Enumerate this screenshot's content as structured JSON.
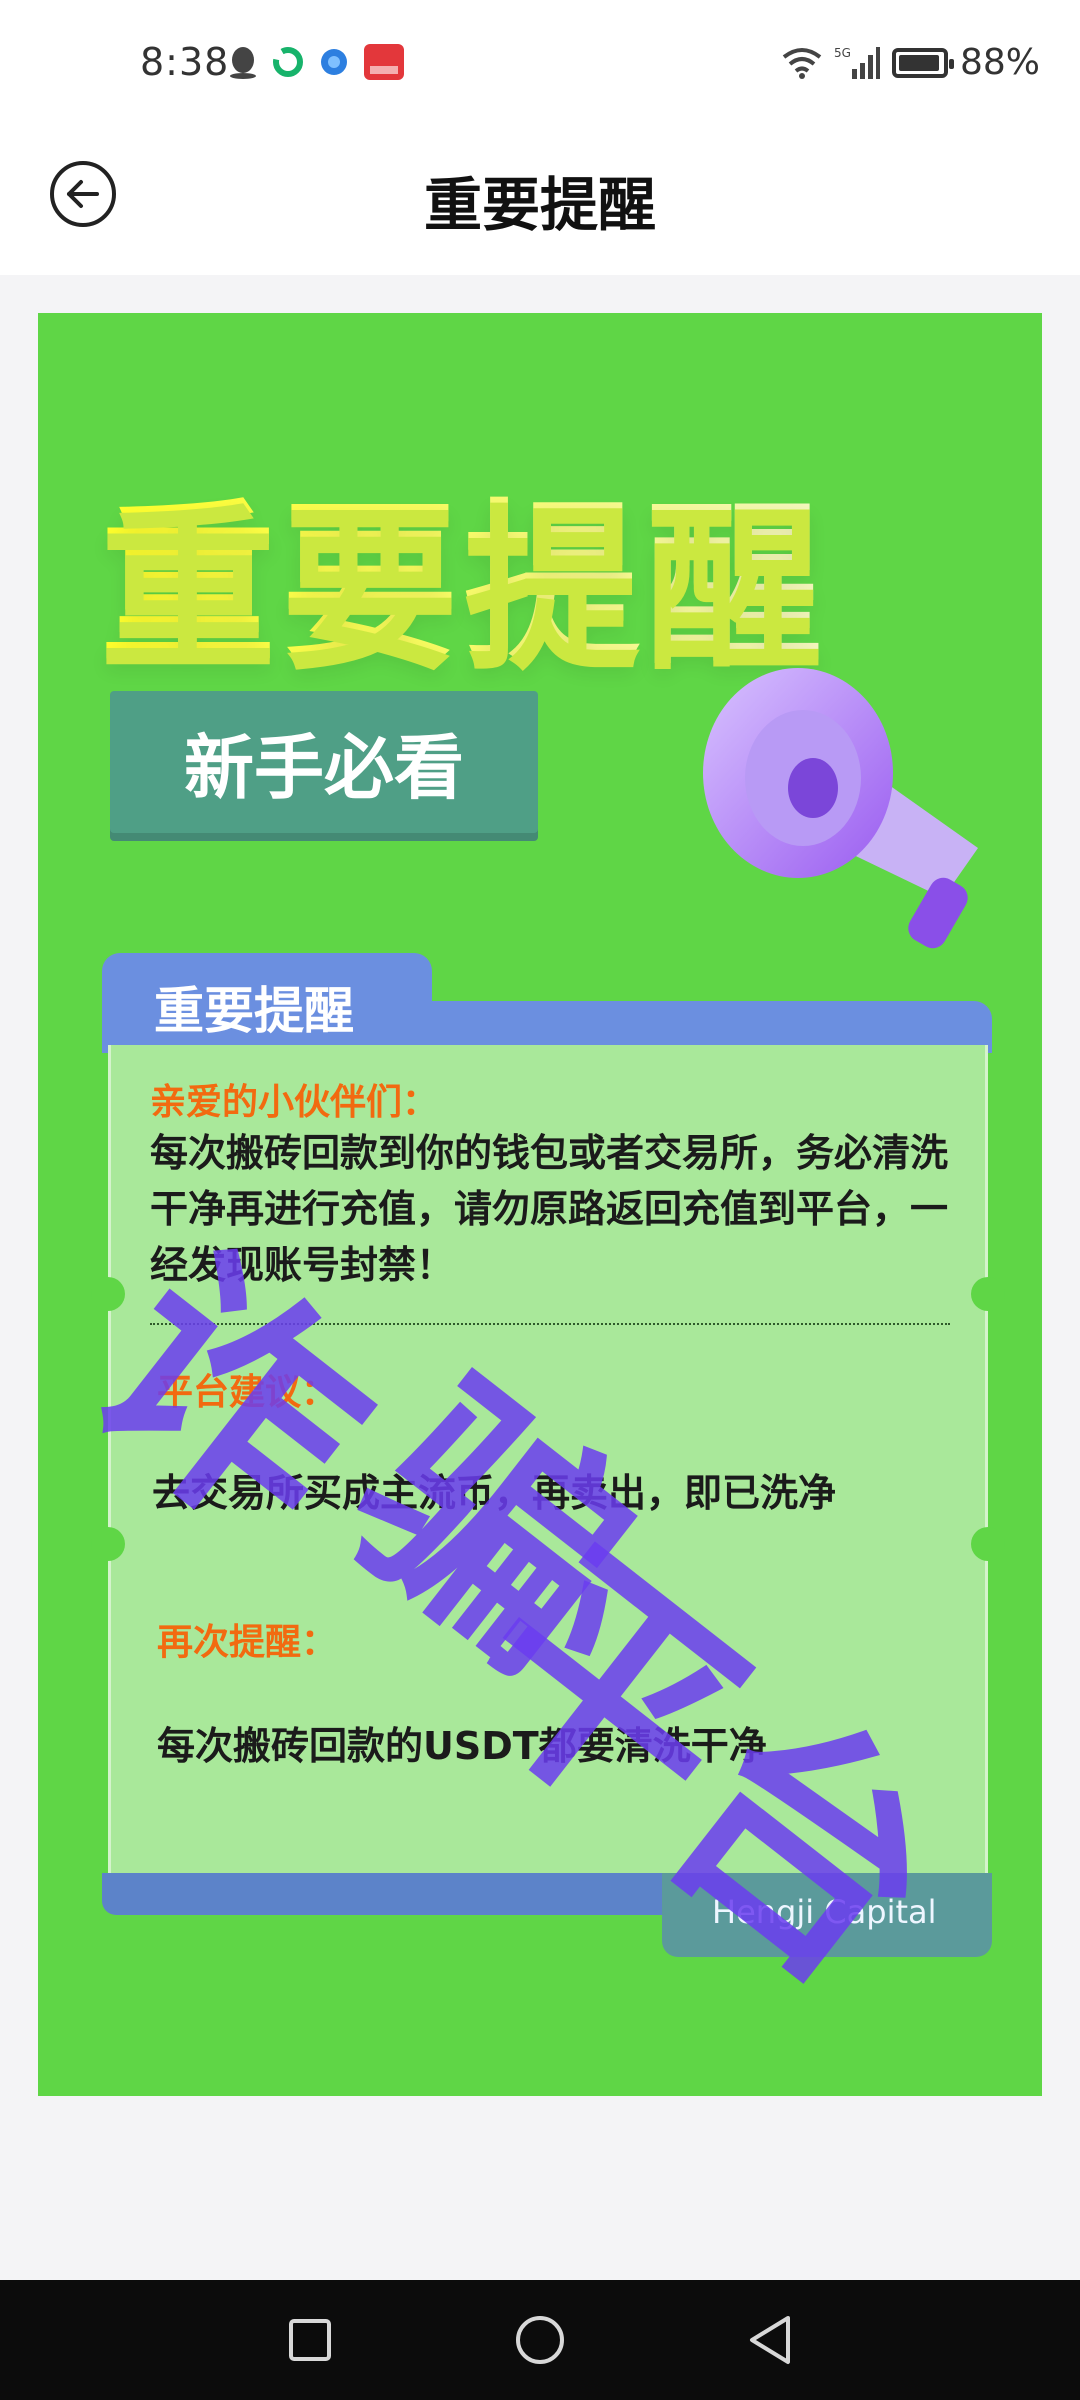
{
  "status_bar": {
    "time": "8:38",
    "network": "5G",
    "battery": "88%"
  },
  "header": {
    "title": "重要提醒"
  },
  "poster": {
    "big_title": "重要提醒",
    "badge": "新手必看",
    "notice": {
      "tab_title": "重要提醒",
      "greeting": "亲爱的小伙伴们：",
      "warning_lines": [
        "每次搬砖回款到你的钱包或者交易所，务必清洗",
        "干净再进行充值，请勿原路返回充值到平台，一",
        "经发现账号封禁！"
      ],
      "suggestion_label": "平台建议：",
      "suggestion_text": "去交易所买成主流币，再卖出，即已洗净",
      "reminder_label": "再次提醒：",
      "reminder_text": "每次搬砖回款的USDT都要清洗干净",
      "brand": "Hengji Capital"
    }
  },
  "watermark": {
    "lines": [
      "诈",
      "骗",
      "平台"
    ]
  },
  "colors": {
    "poster_bg": "#5fd646",
    "title_yellow": "#ffff2a",
    "badge_teal": "#4f9f86",
    "label_orange": "#f26a10",
    "watermark_purple": "#6b3df0"
  }
}
